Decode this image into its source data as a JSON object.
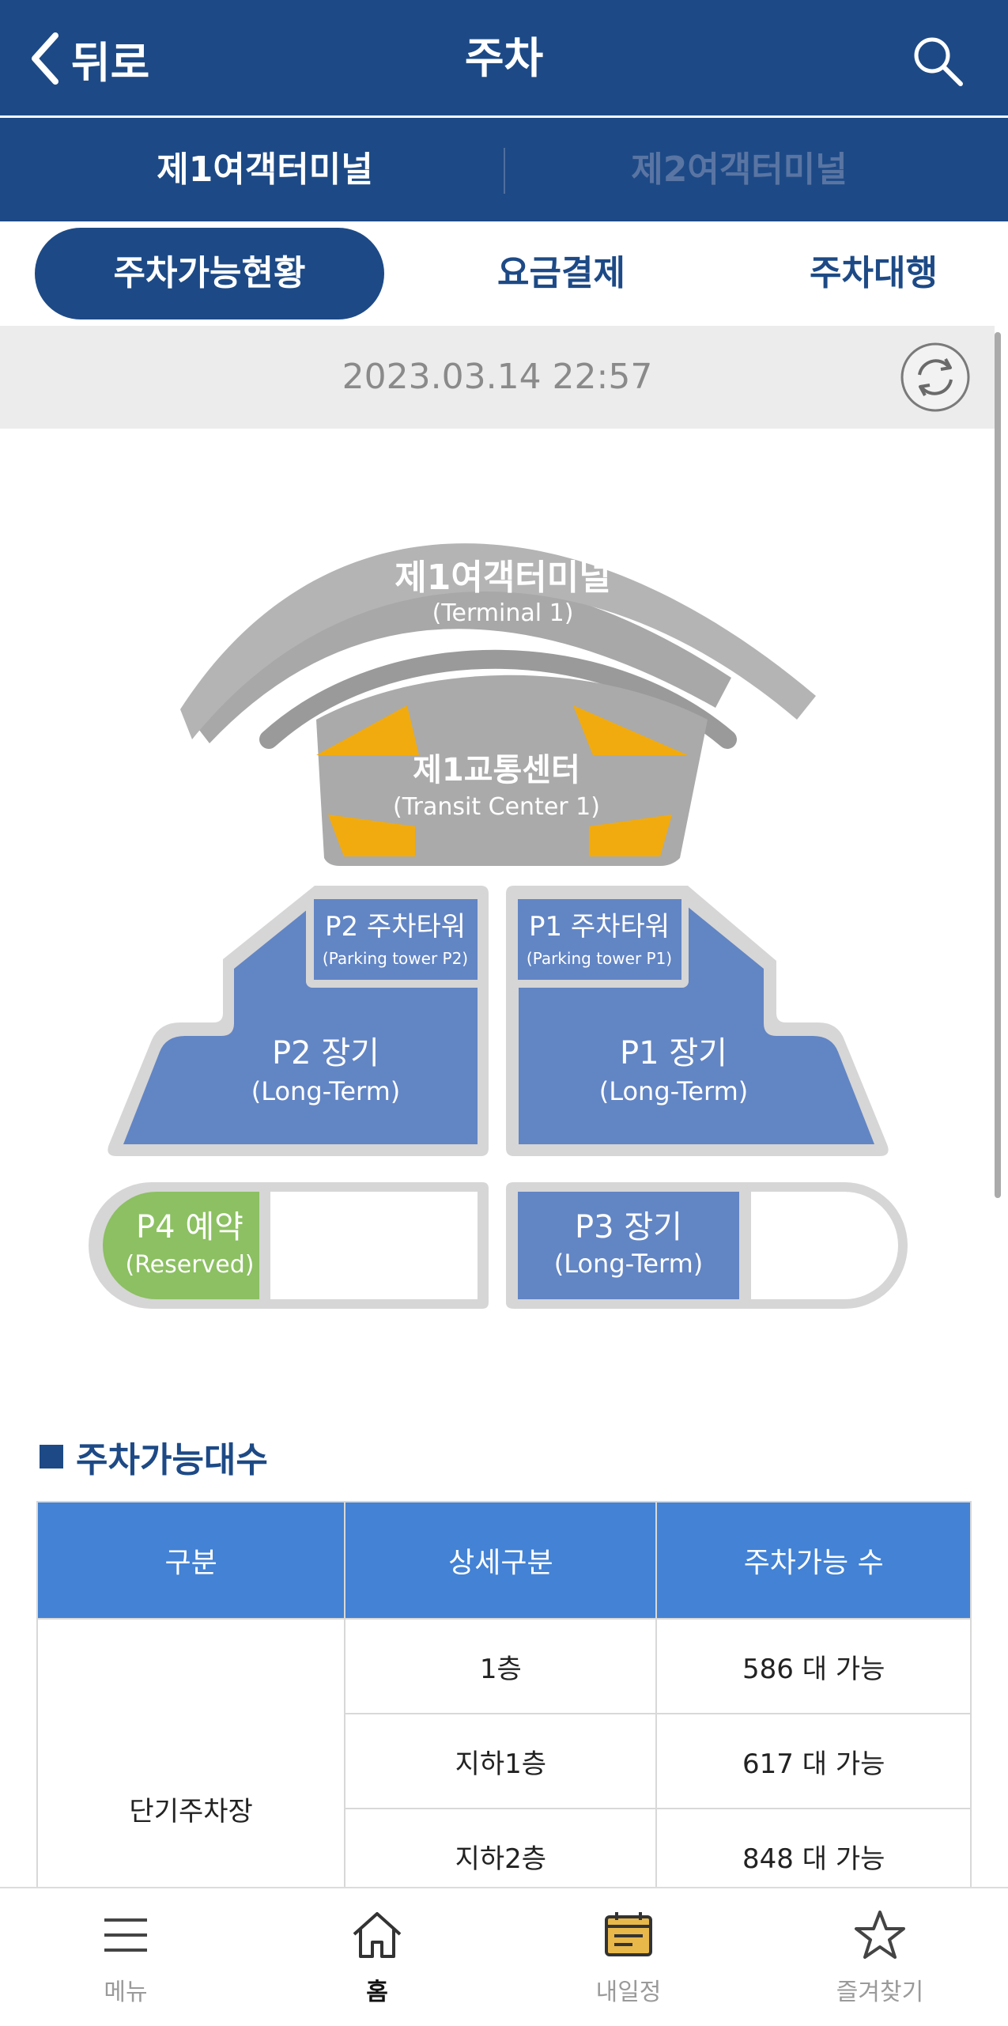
{
  "header": {
    "back_label": "뒤로",
    "title": "주차"
  },
  "terminal_tabs": [
    {
      "label": "제1여객터미널",
      "active": true
    },
    {
      "label": "제2여객터미널",
      "active": false
    }
  ],
  "segments": [
    {
      "label": "주차가능현황",
      "active": true
    },
    {
      "label": "요금결제",
      "active": false
    },
    {
      "label": "주차대행",
      "active": false
    }
  ],
  "timestamp": "2023.03.14 22:57",
  "map": {
    "terminal": {
      "name": "제1여객터미널",
      "sub": "(Terminal 1)"
    },
    "transit": {
      "name": "제1교통센터",
      "sub": "(Transit Center 1)"
    },
    "p2_tower": {
      "name": "P2 주차타워",
      "sub": "(Parking tower P2)"
    },
    "p1_tower": {
      "name": "P1 주차타워",
      "sub": "(Parking tower P1)"
    },
    "p2_long": {
      "name": "P2 장기",
      "sub": "(Long-Term)"
    },
    "p1_long": {
      "name": "P1 장기",
      "sub": "(Long-Term)"
    },
    "p4": {
      "name": "P4 예약",
      "sub": "(Reserved)"
    },
    "p3": {
      "name": "P3 장기",
      "sub": "(Long-Term)"
    }
  },
  "section": {
    "title": "주차가능대수"
  },
  "table": {
    "headers": [
      "구분",
      "상세구분",
      "주차가능 수"
    ],
    "group": "단기주차장",
    "rows": [
      {
        "detail": "1층",
        "count": "586 대 가능"
      },
      {
        "detail": "지하1층",
        "count": "617 대 가능"
      },
      {
        "detail": "지하2층",
        "count": "848 대 가능"
      }
    ]
  },
  "bottom_nav": [
    {
      "label": "메뉴",
      "icon": "menu-icon",
      "active": false
    },
    {
      "label": "홈",
      "icon": "home-icon",
      "active": true
    },
    {
      "label": "내일정",
      "icon": "calendar-icon",
      "active": false
    },
    {
      "label": "즐겨찾기",
      "icon": "star-icon",
      "active": false
    }
  ],
  "colors": {
    "primary": "#1d4a86",
    "table_header": "#4382d4",
    "lot_blue": "#6285c4",
    "reserved_green": "#8cc062",
    "highlight_orange": "#f2ab0e"
  }
}
